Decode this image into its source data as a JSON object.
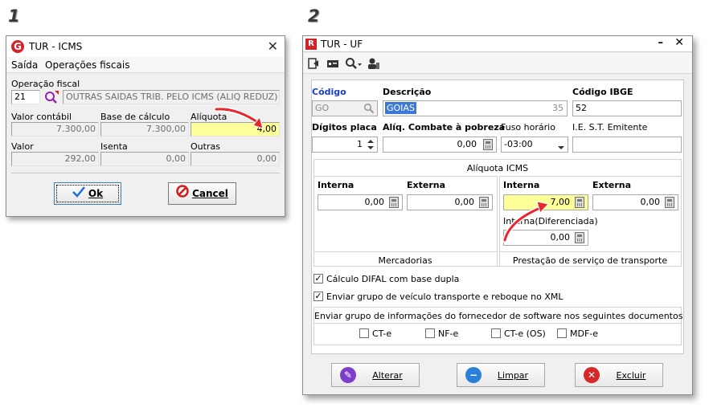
{
  "steps": {
    "one": "1",
    "two": "2"
  },
  "win1": {
    "title": "TUR - ICMS",
    "menu": [
      "Saída",
      "Operações fiscais"
    ],
    "operacao_label": "Operação fiscal",
    "operacao_code": "21",
    "operacao_desc": "OUTRAS SAIDAS TRIB. PELO ICMS (ALIQ REDUZ)",
    "valor_contabil_label": "Valor contábil",
    "valor_contabil": "7.300,00",
    "base_calculo_label": "Base de cálculo",
    "base_calculo": "7.300,00",
    "aliquota_label": "Alíquota",
    "aliquota": "4,00",
    "valor_label": "Valor",
    "valor": "292,00",
    "isenta_label": "Isenta",
    "isenta": "0,00",
    "outras_label": "Outras",
    "outras": "0,00",
    "ok_label": "Ok",
    "cancel_label": "Cancel"
  },
  "win2": {
    "title": "TUR - UF",
    "codigo_label": "Código",
    "codigo": "GO",
    "descricao_label": "Descrição",
    "descricao": "GOIAS",
    "descricao_count": "35",
    "ibge_label": "Código IBGE",
    "ibge": "52",
    "digitos_label": "Dígitos placa",
    "digitos": "1",
    "aliq_pobreza_label": "Alíq. Combate à pobreza",
    "aliq_pobreza": "0,00",
    "fuso_label": "Fuso horário",
    "fuso": "-03:00",
    "ie_label": "I.E. S.T.  Emitente",
    "ie": "",
    "aliquota_icms_label": "Alíquota ICMS",
    "merc_interna_label": "Interna",
    "merc_interna": "0,00",
    "merc_externa_label": "Externa",
    "merc_externa": "0,00",
    "mercadorias_label": "Mercadorias",
    "transp_interna_label": "Interna",
    "transp_interna": "7,00",
    "transp_externa_label": "Externa",
    "transp_externa": "0,00",
    "transp_dif_label": "Interna(Diferenciada)",
    "transp_dif": "0,00",
    "transporte_label": "Prestação de serviço de transporte",
    "chk_difal_label": "Cálculo DIFAL com base dupla",
    "chk_veiculo_label": "Enviar grupo de veículo transporte e reboque no XML",
    "fornecedor_label": "Enviar grupo de informações do fornecedor de software nos seguintes documentos",
    "docs": [
      "CT-e",
      "NF-e",
      "CT-e (OS)",
      "MDF-e"
    ],
    "alterar_label": "Alterar",
    "limpar_label": "Limpar",
    "excluir_label": "Excluir"
  },
  "colors": {
    "highlight": "#ffff99",
    "arrow": "#e8262b",
    "selection": "#3c78d8",
    "label_blue": "#1a3fb8"
  }
}
